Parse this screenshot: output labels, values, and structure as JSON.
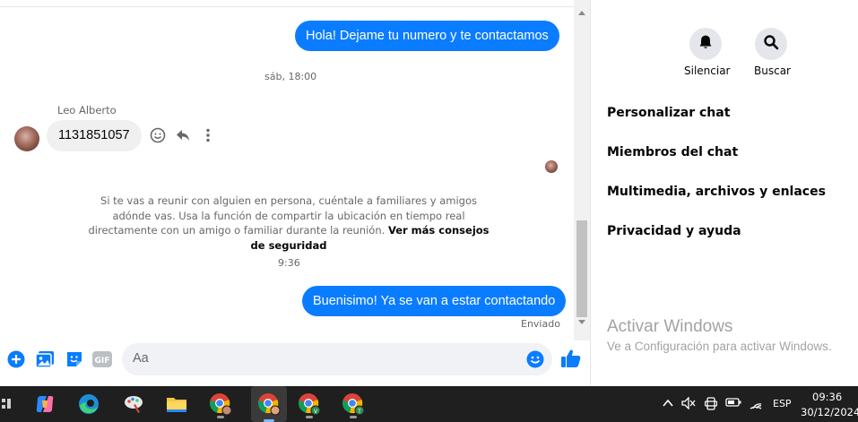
{
  "messages": {
    "out1": "Hola! Dejame tu numero y te contactamos",
    "time1": "sáb, 18:00",
    "sender_name": "Leo Alberto",
    "in1": "1131851057",
    "safety_text": "Si te vas a reunir con alguien en persona, cuéntale a familiares y amigos adónde vas. Usa la función de compartir la ubicación en tiempo real directamente con un amigo o familiar durante la reunión.",
    "safety_link": "Ver más consejos de seguridad",
    "time2": "9:36",
    "out2": "Buenisimo! Ya se van a estar contactando",
    "status": "Enviado"
  },
  "composer": {
    "placeholder": "Aa"
  },
  "right_panel": {
    "mute_label": "Silenciar",
    "search_label": "Buscar",
    "menu": [
      "Personalizar chat",
      "Miembros del chat",
      "Multimedia, archivos y enlaces",
      "Privacidad y ayuda"
    ]
  },
  "watermark": {
    "title": "Activar Windows",
    "subtitle": "Ve a Configuración para activar Windows."
  },
  "taskbar": {
    "language": "ESP",
    "time": "09:36",
    "date": "30/12/2024"
  },
  "colors": {
    "messenger_blue": "#0a7cff",
    "taskbar_bg": "#1f1f1f"
  }
}
